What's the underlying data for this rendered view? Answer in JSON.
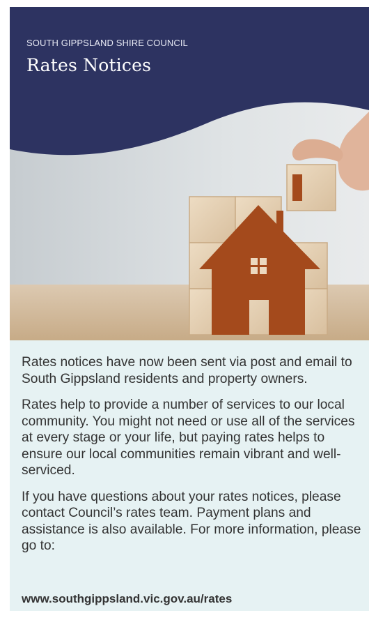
{
  "header": {
    "kicker": "SOUTH GIPPSLAND SHIRE COUNCIL",
    "title": "Rates Notices"
  },
  "hero": {
    "image_description_icon": "house-blocks-illustration"
  },
  "body": {
    "paragraphs": [
      "Rates notices have now been sent via post and email to South Gippsland residents and property owners.",
      "Rates help to provide a number of services to our local community. You might not need or use all of the services at every stage or your life, but paying rates helps to ensure our local communities remain vibrant and well-serviced.",
      "If you have questions about your rates notices, please contact Council’s rates team. Payment plans and assistance is also available. For more information, please go to:"
    ],
    "link": "www.southgippsland.vic.gov.au/rates"
  },
  "colors": {
    "navy": "#2d3361",
    "panel": "#e6f2f3",
    "text": "#333333"
  }
}
